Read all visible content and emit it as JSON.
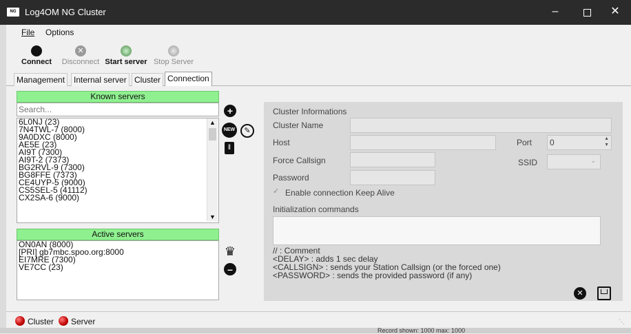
{
  "window": {
    "title": "Log4OM NG Cluster",
    "app_icon": "log4om-icon"
  },
  "menu": {
    "file": "File",
    "options": "Options"
  },
  "toolbar": {
    "connect": "Connect",
    "disconnect": "Disconnect",
    "start_server": "Start server",
    "stop_server": "Stop Server"
  },
  "tabs": [
    "Management",
    "Internal server",
    "Cluster",
    "Connection"
  ],
  "known_servers": {
    "header": "Known servers",
    "search_placeholder": "Search...",
    "items": [
      "6L0NJ (23)",
      "7N4TWL-7 (8000)",
      "9A0DXC (8000)",
      "AE5E (23)",
      "AI9T (7300)",
      "AI9T-2 (7373)",
      "BG2RVL-9 (7300)",
      "BG8FFE (7373)",
      "CE4UYP-5 (9000)",
      "CS5SEL-5 (41112)",
      "CX2SA-6 (9000)"
    ]
  },
  "active_servers": {
    "header": "Active servers",
    "items": [
      "ON0AN (8000)",
      "[PRI] gb7mbc.spoo.org:8000",
      "EI7MRE (7300)",
      "VE7CC (23)"
    ]
  },
  "cluster_info": {
    "title": "Cluster Informations",
    "cluster_name_label": "Cluster Name",
    "host_label": "Host",
    "port_label": "Port",
    "port_value": "0",
    "force_callsign_label": "Force Callsign",
    "ssid_label": "SSID",
    "password_label": "Password",
    "keepalive_label": "Enable connection Keep Alive",
    "init_commands_label": "Initialization commands",
    "help_lines": [
      "// : Comment",
      "<DELAY> : adds 1 sec delay",
      "<CALLSIGN> : sends your Station Callsign (or the forced one)",
      "<PASSWORD> : sends the provided password (if any)"
    ]
  },
  "statusbar": {
    "cluster": "Cluster",
    "server": "Server"
  },
  "background_window": {
    "record_text": "Record shown: 1000 max: 1000"
  },
  "colors": {
    "titlebar": "#2b2b2b",
    "green_header": "#8ff08f",
    "panel": "#d9d9d9",
    "led": "#c00000"
  }
}
